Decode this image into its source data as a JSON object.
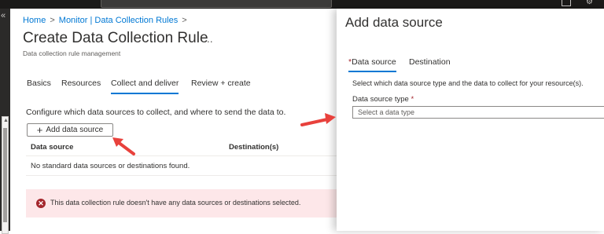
{
  "breadcrumb": {
    "items": [
      "Home",
      "Monitor | Data Collection Rules"
    ],
    "separator": ">"
  },
  "page": {
    "title": "Create Data Collection Rule",
    "more_label": "...",
    "subtitle": "Data collection rule management"
  },
  "tabs": [
    {
      "label": "Basics"
    },
    {
      "label": "Resources"
    },
    {
      "label": "Collect and deliver"
    },
    {
      "label": "Review + create"
    }
  ],
  "active_tab": "Collect and deliver",
  "collect": {
    "intro": "Configure which data sources to collect, and where to send the data to.",
    "add_button_label": "Add data source",
    "columns": [
      "Data source",
      "Destination(s)"
    ],
    "empty_message": "No standard data sources or destinations found."
  },
  "error": {
    "message": "This data collection rule doesn't have any data sources or destinations selected."
  },
  "panel": {
    "title": "Add data source",
    "tabs": [
      {
        "label": "Data source",
        "required": true
      },
      {
        "label": "Destination",
        "required": false
      }
    ],
    "active_tab": "Data source",
    "description": "Select which data source type and the data to collect for your resource(s).",
    "field_label": "Data source type",
    "required_marker": "*",
    "select_placeholder": "Select a data type"
  },
  "icons": {
    "collapse": "double-chevron-left-icon",
    "add": "plus-icon",
    "error": "error-circle-icon",
    "annotation": "red-arrow-icon"
  },
  "colors": {
    "accent": "#0078d4",
    "error_bg": "#fde7e9",
    "error_icon": "#a4262c",
    "annotation": "#e8413c"
  }
}
